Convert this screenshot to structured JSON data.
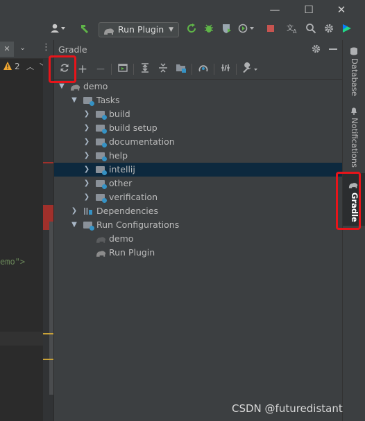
{
  "window": {
    "controls": [
      {
        "name": "minimize-icon",
        "glyph": "—"
      },
      {
        "name": "maximize-icon",
        "glyph": "☐"
      },
      {
        "name": "close-icon",
        "glyph": "✕"
      }
    ]
  },
  "toolbar": {
    "run_config": "Run Plugin"
  },
  "editor": {
    "warning_count": "2",
    "code_fragment": "emo\">"
  },
  "gradle": {
    "title": "Gradle",
    "tree": [
      {
        "label": "demo",
        "icon": "gradle-elephant-icon",
        "expander": "expanded"
      },
      {
        "label": "Tasks",
        "icon": "folder-icon",
        "expander": "expanded"
      },
      {
        "label": "build",
        "icon": "task-folder-icon",
        "expander": "collapsed"
      },
      {
        "label": "build setup",
        "icon": "task-folder-icon",
        "expander": "collapsed"
      },
      {
        "label": "documentation",
        "icon": "task-folder-icon",
        "expander": "collapsed"
      },
      {
        "label": "help",
        "icon": "task-folder-icon",
        "expander": "collapsed"
      },
      {
        "label": "intellij",
        "icon": "task-folder-icon",
        "expander": "collapsed",
        "selected": true
      },
      {
        "label": "other",
        "icon": "task-folder-icon",
        "expander": "collapsed"
      },
      {
        "label": "verification",
        "icon": "task-folder-icon",
        "expander": "collapsed"
      },
      {
        "label": "Dependencies",
        "icon": "dependencies-icon",
        "expander": "collapsed"
      },
      {
        "label": "Run Configurations",
        "icon": "folder-icon",
        "expander": "expanded"
      },
      {
        "label": "demo",
        "icon": "gradle-elephant-icon",
        "expander": "none"
      },
      {
        "label": "Run Plugin",
        "icon": "gradle-elephant-icon",
        "expander": "none"
      }
    ]
  },
  "side_tabs": [
    {
      "label": "Database"
    },
    {
      "label": "Notifications"
    },
    {
      "label": "Gradle",
      "active": true
    }
  ],
  "watermark": "CSDN @futuredistant",
  "colors": {
    "highlight": "#e8141a",
    "selection": "#0d293e",
    "panel": "#3c3f41",
    "editor": "#2b2b2b"
  }
}
